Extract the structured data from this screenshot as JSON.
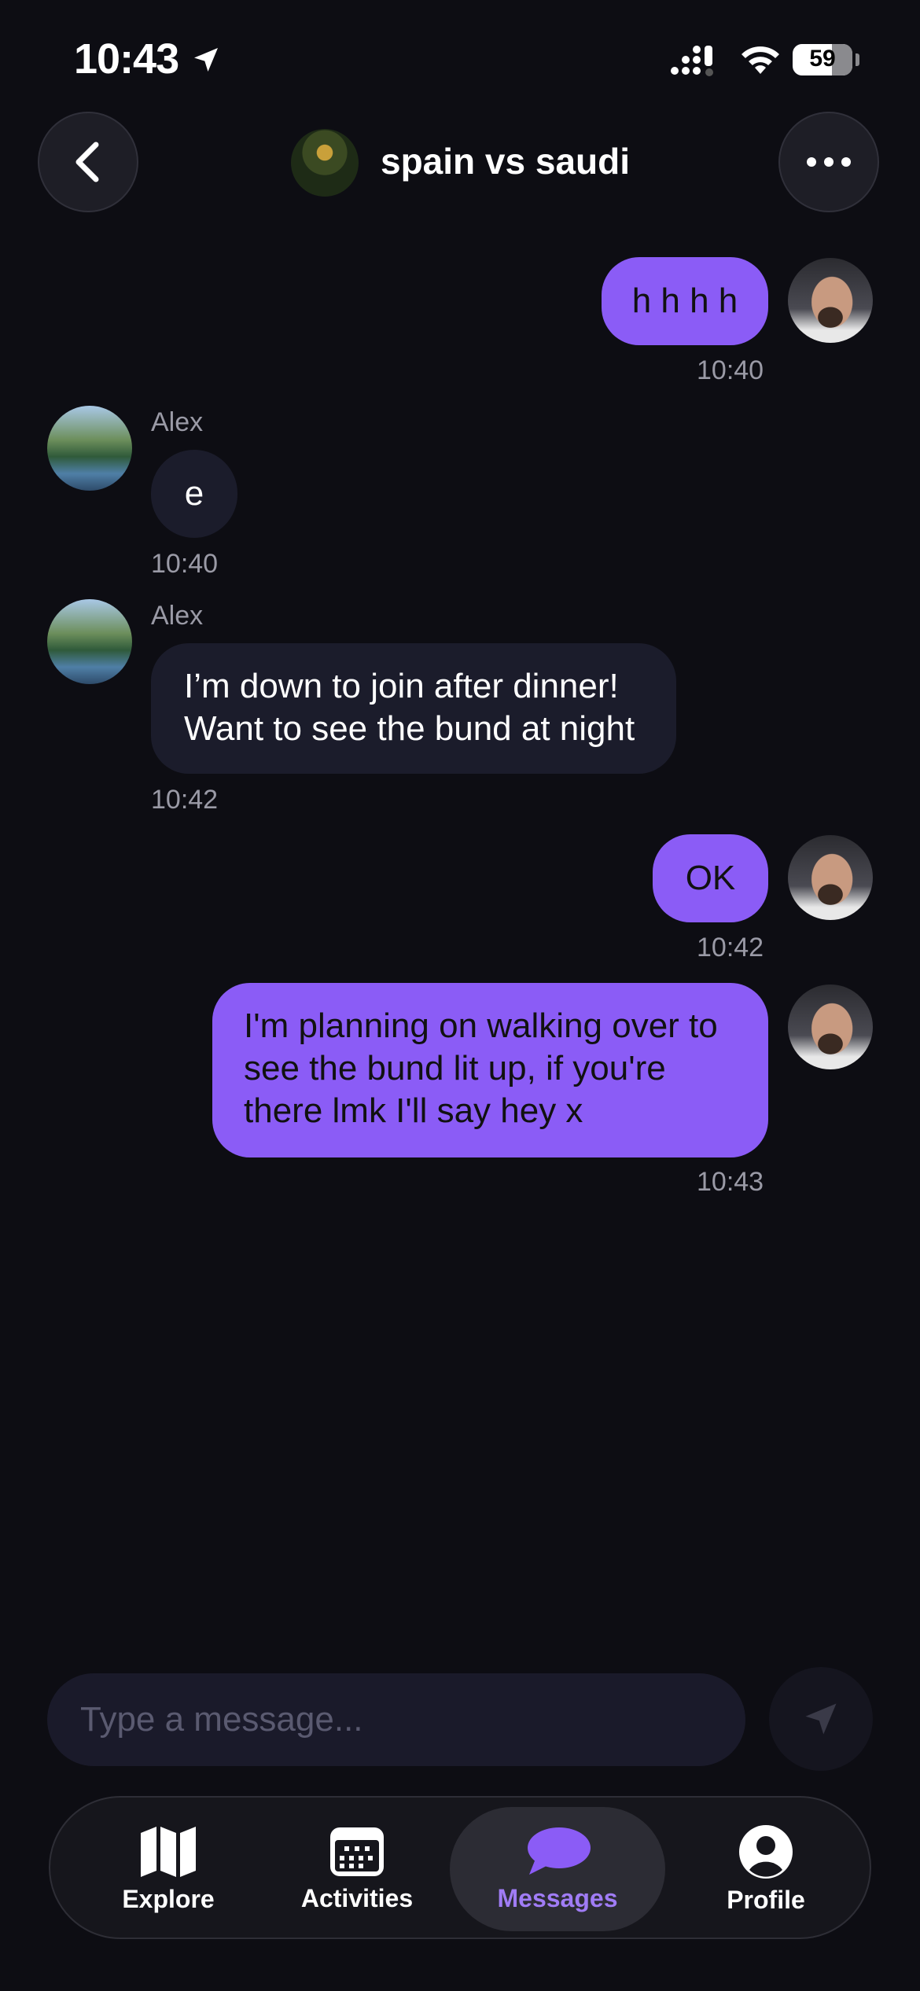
{
  "status_bar": {
    "time": "10:43",
    "battery": "59"
  },
  "header": {
    "title": "spain vs saudi"
  },
  "messages": [
    {
      "text": "h h h h",
      "time": "10:40"
    },
    {
      "sender": "Alex",
      "text": "e",
      "time": "10:40"
    },
    {
      "sender": "Alex",
      "line1": "I’m down to join after dinner!",
      "line2": "Want to see the bund at night",
      "time": "10:42"
    },
    {
      "text": "OK",
      "time": "10:42"
    },
    {
      "line1": "I'm planning on walking over to",
      "line2": "see the bund lit up, if you're",
      "line3": "there lmk I'll say hey x",
      "time": "10:43"
    }
  ],
  "composer": {
    "placeholder": "Type a message..."
  },
  "tabs": [
    {
      "label": "Explore",
      "icon": "map-icon"
    },
    {
      "label": "Activities",
      "icon": "calendar-icon"
    },
    {
      "label": "Messages",
      "icon": "chat-bubble-icon"
    },
    {
      "label": "Profile",
      "icon": "profile-icon"
    }
  ],
  "colors": {
    "accent": "#8b5cf6",
    "background": "#0d0d13",
    "incoming_bubble": "#1b1c2b"
  }
}
